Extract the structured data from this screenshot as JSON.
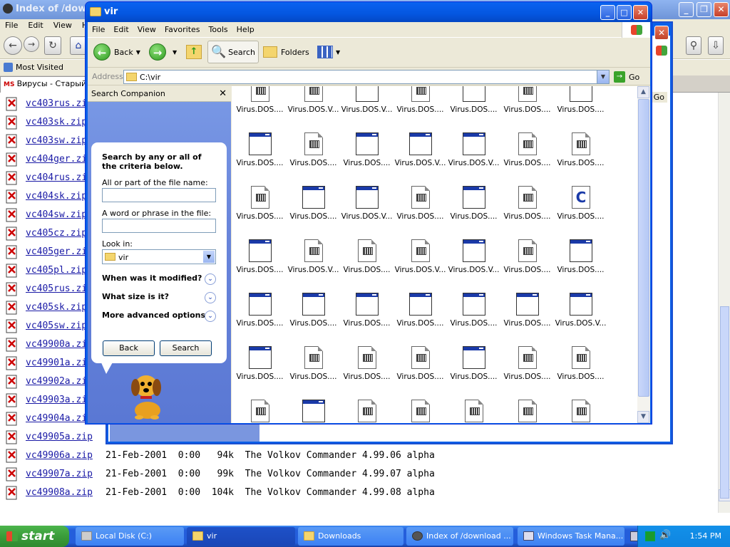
{
  "bg_browser": {
    "title": "Index of /downl",
    "menu": [
      "File",
      "Edit",
      "View",
      "H"
    ],
    "most_visited": "Most Visited",
    "tab": "Вирусы - Старый D",
    "go_tab": "Go",
    "files": [
      {
        "name": "vc403rus.zip",
        "meta": ""
      },
      {
        "name": "vc403sk.zip",
        "meta": ""
      },
      {
        "name": "vc403sw.zip",
        "meta": ""
      },
      {
        "name": "vc404ger.zip",
        "meta": ""
      },
      {
        "name": "vc404rus.zip",
        "meta": ""
      },
      {
        "name": "vc404sk.zip",
        "meta": ""
      },
      {
        "name": "vc404sw.zip",
        "meta": ""
      },
      {
        "name": "vc405cz.zip",
        "meta": ""
      },
      {
        "name": "vc405ger.zip",
        "meta": ""
      },
      {
        "name": "vc405pl.zip",
        "meta": ""
      },
      {
        "name": "vc405rus.zip",
        "meta": ""
      },
      {
        "name": "vc405sk.zip",
        "meta": ""
      },
      {
        "name": "vc405sw.zip",
        "meta": ""
      },
      {
        "name": "vc49900a.zip",
        "meta": ""
      },
      {
        "name": "vc49901a.zip",
        "meta": ""
      },
      {
        "name": "vc49902a.zip",
        "meta": ""
      },
      {
        "name": "vc49903a.zip",
        "meta": ""
      },
      {
        "name": "vc49904a.zip",
        "meta": ""
      },
      {
        "name": "vc49905a.zip",
        "meta": ""
      },
      {
        "name": "vc49906a.zip",
        "meta": "21-Feb-2001  0:00   94k  The Volkov Commander 4.99.06 alpha"
      },
      {
        "name": "vc49907a.zip",
        "meta": "21-Feb-2001  0:00   99k  The Volkov Commander 4.99.07 alpha"
      },
      {
        "name": "vc49908a.zip",
        "meta": "21-Feb-2001  0:00  104k  The Volkov Commander 4.99.08 alpha"
      }
    ]
  },
  "explorer": {
    "title": "vir",
    "menu": [
      "File",
      "Edit",
      "View",
      "Favorites",
      "Tools",
      "Help"
    ],
    "toolbar": {
      "back": "Back",
      "search": "Search",
      "folders": "Folders"
    },
    "address_label": "Address",
    "address_value": "C:\\vir",
    "go_label": "Go",
    "search_pane": {
      "title": "Search Companion",
      "heading": "Search by any or all of the criteria below.",
      "filename_label": "All or part of the file name:",
      "phrase_label": "A word or phrase in the file:",
      "lookin_label": "Look in:",
      "lookin_value": "vir",
      "modified": "When was it modified?",
      "size": "What size is it?",
      "advanced": "More advanced options",
      "back_btn": "Back",
      "search_btn": "Search"
    },
    "grid": [
      [
        {
          "t": "doc",
          "l": "Virus.DOS...."
        },
        {
          "t": "doc",
          "l": "Virus.DOS.V..."
        },
        {
          "t": "app",
          "l": "Virus.DOS.V..."
        },
        {
          "t": "doc",
          "l": "Virus.DOS...."
        },
        {
          "t": "app",
          "l": "Virus.DOS...."
        },
        {
          "t": "doc",
          "l": "Virus.DOS...."
        },
        {
          "t": "app",
          "l": "Virus.DOS...."
        }
      ],
      [
        {
          "t": "app",
          "l": "Virus.DOS...."
        },
        {
          "t": "doc",
          "l": "Virus.DOS...."
        },
        {
          "t": "app",
          "l": "Virus.DOS...."
        },
        {
          "t": "app",
          "l": "Virus.DOS.V..."
        },
        {
          "t": "app",
          "l": "Virus.DOS.V..."
        },
        {
          "t": "doc",
          "l": "Virus.DOS...."
        },
        {
          "t": "doc",
          "l": "Virus.DOS...."
        }
      ],
      [
        {
          "t": "doc",
          "l": "Virus.DOS...."
        },
        {
          "t": "app",
          "l": "Virus.DOS...."
        },
        {
          "t": "app",
          "l": "Virus.DOS.V..."
        },
        {
          "t": "doc",
          "l": "Virus.DOS...."
        },
        {
          "t": "app",
          "l": "Virus.DOS...."
        },
        {
          "t": "doc",
          "l": "Virus.DOS...."
        },
        {
          "t": "c",
          "l": "Virus.DOS...."
        }
      ],
      [
        {
          "t": "app",
          "l": "Virus.DOS...."
        },
        {
          "t": "doc",
          "l": "Virus.DOS.V..."
        },
        {
          "t": "doc",
          "l": "Virus.DOS...."
        },
        {
          "t": "doc",
          "l": "Virus.DOS.V..."
        },
        {
          "t": "app",
          "l": "Virus.DOS.V..."
        },
        {
          "t": "doc",
          "l": "Virus.DOS...."
        },
        {
          "t": "app",
          "l": "Virus.DOS...."
        }
      ],
      [
        {
          "t": "app",
          "l": "Virus.DOS...."
        },
        {
          "t": "app",
          "l": "Virus.DOS...."
        },
        {
          "t": "app",
          "l": "Virus.DOS...."
        },
        {
          "t": "app",
          "l": "Virus.DOS...."
        },
        {
          "t": "app",
          "l": "Virus.DOS...."
        },
        {
          "t": "app",
          "l": "Virus.DOS...."
        },
        {
          "t": "app",
          "l": "Virus.DOS.V..."
        }
      ],
      [
        {
          "t": "app",
          "l": "Virus.DOS...."
        },
        {
          "t": "doc",
          "l": "Virus.DOS...."
        },
        {
          "t": "doc",
          "l": "Virus.DOS...."
        },
        {
          "t": "doc",
          "l": "Virus.DOS...."
        },
        {
          "t": "app",
          "l": "Virus.DOS...."
        },
        {
          "t": "doc",
          "l": "Virus.DOS...."
        },
        {
          "t": "doc",
          "l": "Virus.DOS...."
        }
      ],
      [
        {
          "t": "doc",
          "l": ""
        },
        {
          "t": "app",
          "l": ""
        },
        {
          "t": "doc",
          "l": ""
        },
        {
          "t": "doc",
          "l": ""
        },
        {
          "t": "doc",
          "l": ""
        },
        {
          "t": "doc",
          "l": ""
        },
        {
          "t": "doc",
          "l": ""
        }
      ]
    ]
  },
  "taskbar": {
    "start": "start",
    "tasks": [
      "Local Disk (C:)",
      "vir",
      "Downloads",
      "Index of /download ...",
      "Windows Task Mana..."
    ],
    "clock": "1:54 PM"
  }
}
